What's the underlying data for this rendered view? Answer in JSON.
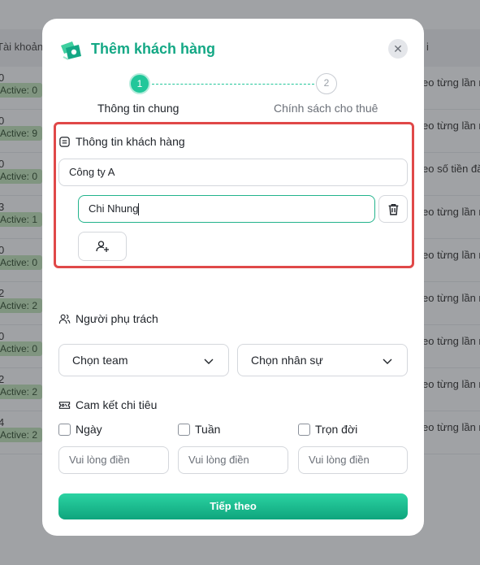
{
  "background": {
    "header_left": "Tài khoản",
    "header_right": "i",
    "rows": [
      {
        "num": "0",
        "badge": "Active: 0",
        "right": "eo từng lần n"
      },
      {
        "num": "0",
        "badge": "Active: 9",
        "right": "eo từng lần n"
      },
      {
        "num": "0",
        "badge": "Active: 0",
        "right": "eo số tiền đă"
      },
      {
        "num": "3",
        "badge": "Active: 1",
        "right": "eo từng lần n"
      },
      {
        "num": "0",
        "badge": "Active: 0",
        "right": "eo từng lần n"
      },
      {
        "num": "2",
        "badge": "Active: 2",
        "right": "eo từng lần n"
      },
      {
        "num": "0",
        "badge": "Active: 0",
        "right": "eo từng lần n"
      },
      {
        "num": "2",
        "badge": "Active: 2",
        "right": "eo từng lần n"
      },
      {
        "num": "4",
        "badge": "Active: 2",
        "right": "eo từng lần n"
      }
    ]
  },
  "modal": {
    "title": "Thêm khách hàng",
    "close_glyph": "✕",
    "steps": [
      {
        "number": "1",
        "label": "Thông tin chung",
        "active": true
      },
      {
        "number": "2",
        "label": "Chính sách cho thuê",
        "active": false
      }
    ],
    "customer_section": {
      "heading": "Thông tin khách hàng",
      "company_value": "Công ty A",
      "contact_value": "Chi Nhung"
    },
    "owner_section": {
      "heading": "Người phụ trách",
      "team_select": "Chọn team",
      "staff_select": "Chọn nhân sự"
    },
    "commit_section": {
      "heading": "Cam kết chi tiêu",
      "options": [
        {
          "label": "Ngày",
          "checked": false,
          "placeholder": "Vui lòng điền"
        },
        {
          "label": "Tuần",
          "checked": false,
          "placeholder": "Vui lòng điền"
        },
        {
          "label": "Trọn đời",
          "checked": false,
          "placeholder": "Vui lòng điền"
        }
      ]
    },
    "next_button": "Tiếp theo"
  },
  "colors": {
    "accent": "#14a885",
    "highlight": "#e04848",
    "overlay": "rgba(60,62,66,0.45)"
  }
}
